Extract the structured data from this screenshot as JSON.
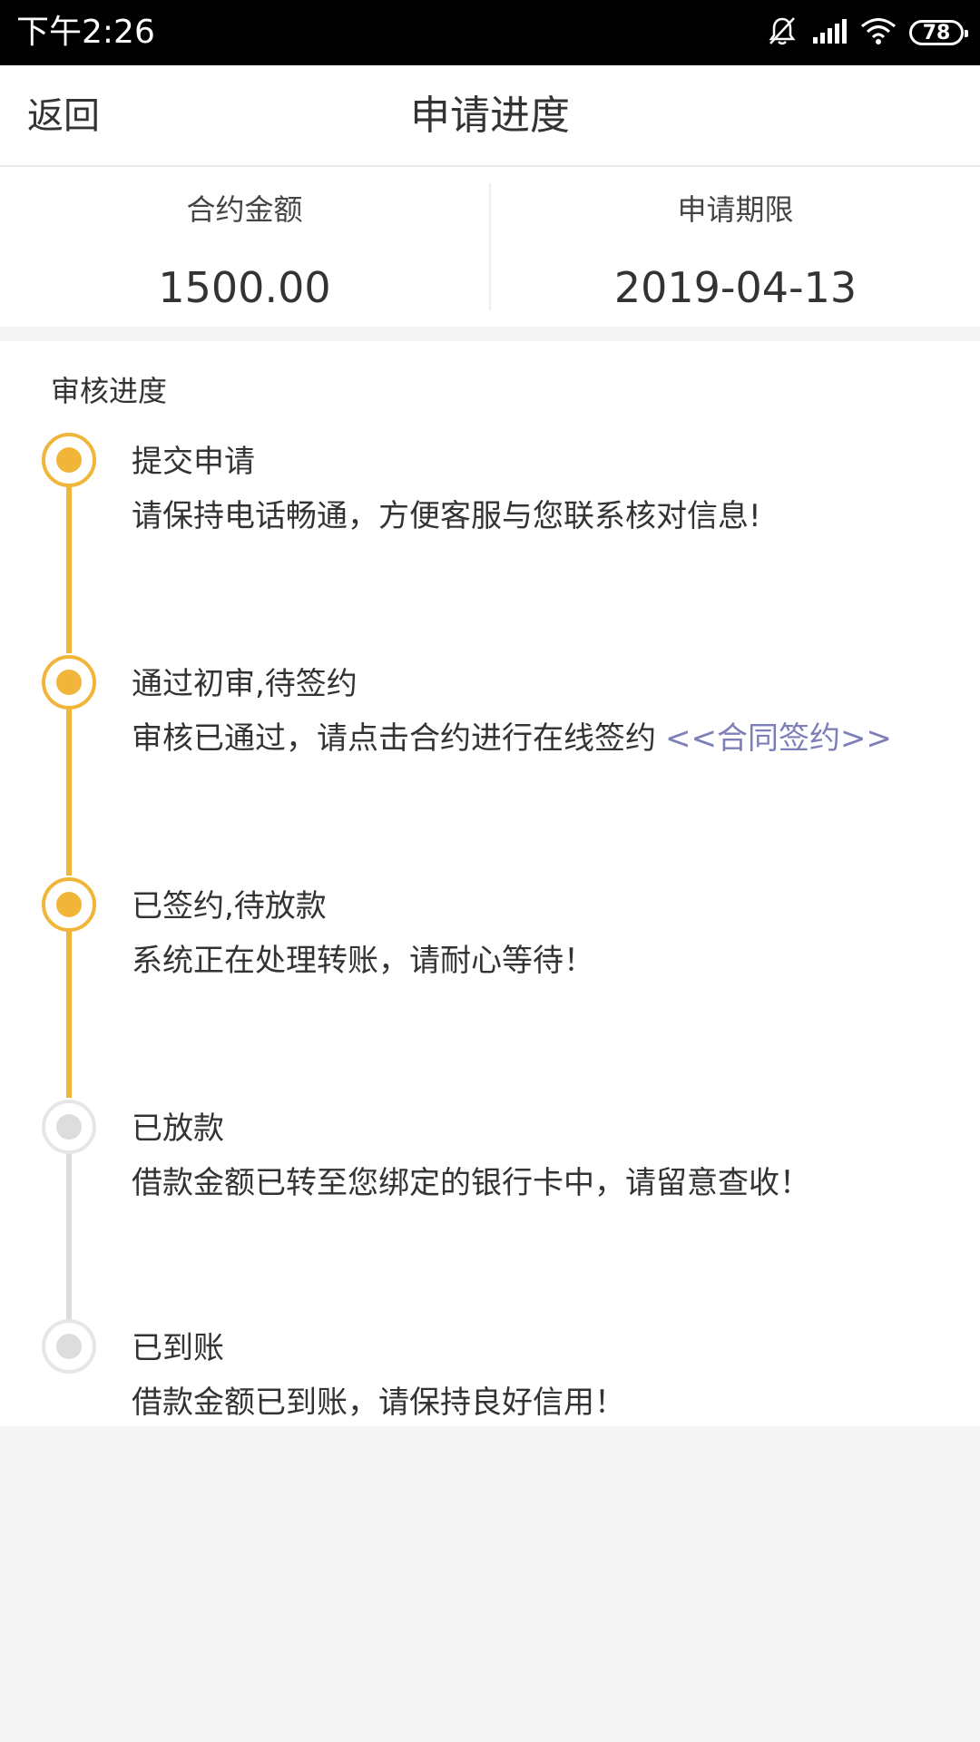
{
  "status_bar": {
    "time": "下午2:26",
    "battery": "78",
    "icons": [
      "mute-icon",
      "signal-icon",
      "wifi-icon",
      "battery-icon"
    ]
  },
  "nav": {
    "back_label": "返回",
    "title": "申请进度"
  },
  "summary": {
    "amount_label": "合约金额",
    "amount_value": "1500.00",
    "term_label": "申请期限",
    "term_value": "2019-04-13"
  },
  "progress": {
    "title": "审核进度",
    "colors": {
      "done": "#f0b539",
      "pending": "#dddddd",
      "link": "#7d7fb8"
    },
    "steps": [
      {
        "name": "提交申请",
        "desc": "请保持电话畅通，方便客服与您联系核对信息!",
        "status": "done",
        "link": ""
      },
      {
        "name": "通过初审,待签约",
        "desc": "审核已通过，请点击合约进行在线签约",
        "status": "done",
        "link": "<<合同签约>>"
      },
      {
        "name": "已签约,待放款",
        "desc": "系统正在处理转账，请耐心等待！",
        "status": "done",
        "link": ""
      },
      {
        "name": "已放款",
        "desc": "借款金额已转至您绑定的银行卡中，请留意查收！",
        "status": "pending",
        "link": ""
      },
      {
        "name": "已到账",
        "desc": "借款金额已到账，请保持良好信用！",
        "status": "pending",
        "link": ""
      }
    ]
  }
}
